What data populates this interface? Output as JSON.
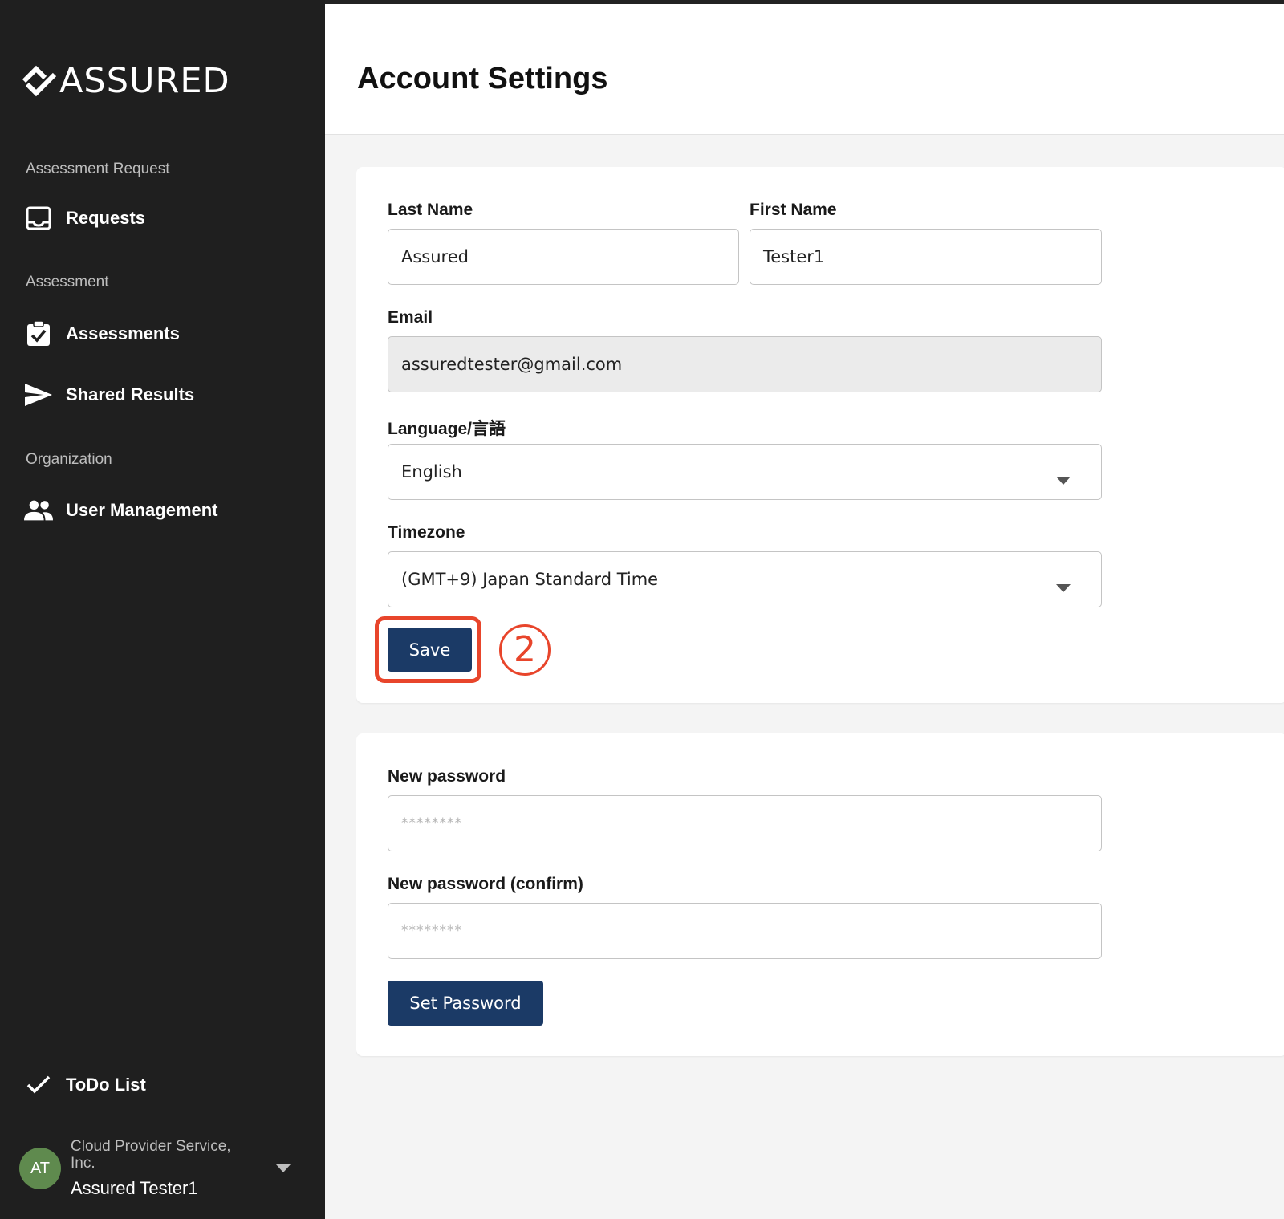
{
  "app": {
    "logo_text": "ASSURED"
  },
  "sidebar": {
    "sections": [
      {
        "label": "Assessment Request"
      },
      {
        "label": "Assessment"
      },
      {
        "label": "Organization"
      }
    ],
    "items": [
      {
        "label": "Requests",
        "icon": "inbox-icon"
      },
      {
        "label": "Assessments",
        "icon": "clipboard-check-icon"
      },
      {
        "label": "Shared Results",
        "icon": "send-icon"
      },
      {
        "label": "User Management",
        "icon": "users-icon"
      },
      {
        "label": "ToDo List",
        "icon": "check-icon"
      }
    ],
    "user": {
      "initials": "AT",
      "org": "Cloud Provider Service, Inc.",
      "name": "Assured Tester1"
    }
  },
  "header": {
    "title": "Account Settings"
  },
  "profile_form": {
    "last_name": {
      "label": "Last Name",
      "value": "Assured"
    },
    "first_name": {
      "label": "First Name",
      "value": "Tester1"
    },
    "email": {
      "label": "Email",
      "value": "assuredtester@gmail.com"
    },
    "language": {
      "label": "Language/言語",
      "value": "English"
    },
    "timezone": {
      "label": "Timezone",
      "value": "(GMT+9) Japan Standard Time"
    },
    "save_label": "Save",
    "step_marker": "2"
  },
  "password_form": {
    "new_password": {
      "label": "New password",
      "placeholder": "********"
    },
    "confirm_password": {
      "label": "New password (confirm)",
      "placeholder": "********"
    },
    "submit_label": "Set Password"
  },
  "colors": {
    "primary": "#1b3a66",
    "highlight": "#e8452b",
    "sidebar_bg": "#1f1f1f",
    "avatar": "#5f8a4e"
  }
}
